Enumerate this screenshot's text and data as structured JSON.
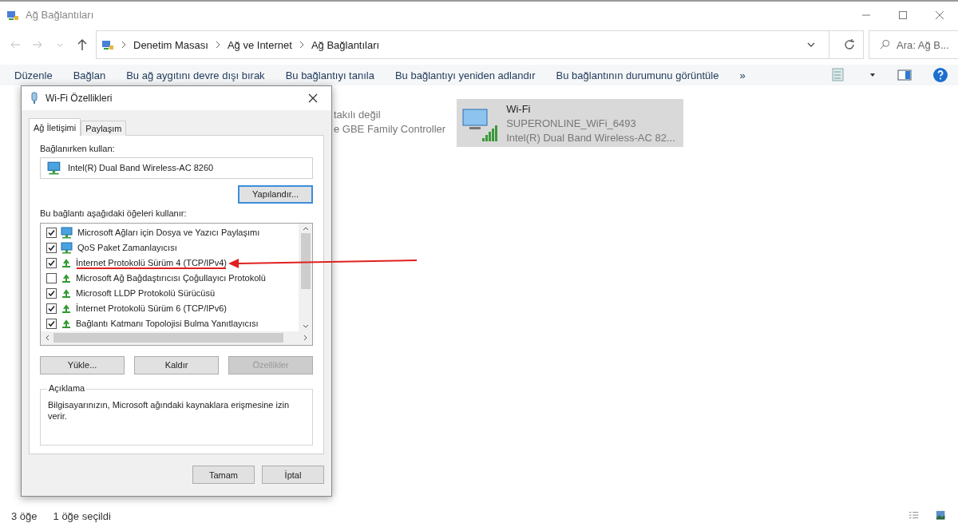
{
  "window": {
    "title": "Ağ Bağlantıları"
  },
  "address_bar": {
    "breadcrumbs": [
      "Denetim Masası",
      "Ağ ve Internet",
      "Ağ Bağlantıları"
    ],
    "search_placeholder": "Ara: Ağ B..."
  },
  "toolbar": {
    "items": [
      "Düzenle",
      "Bağlan",
      "Bu ağ aygıtını devre dışı bırak",
      "Bu bağlantıyı tanıla",
      "Bu bağlantıyı yeniden adlandır",
      "Bu bağlantının durumunu görüntüle"
    ],
    "overflow": "»"
  },
  "connections": [
    {
      "kind": "ethernet",
      "selected": false,
      "lines": [
        "takılı değil",
        "e GBE Family Controller"
      ]
    },
    {
      "kind": "wifi",
      "selected": true,
      "name": "Wi-Fi",
      "lines": [
        "SUPERONLINE_WiFi_6493",
        "Intel(R) Dual Band Wireless-AC 82..."
      ]
    }
  ],
  "status_bar": [
    "3 öğe",
    "1 öğe seçildi"
  ],
  "dialog": {
    "title": "Wi-Fi Özellikleri",
    "tabs": [
      {
        "label": "Ağ İletişimi",
        "selected": true
      },
      {
        "label": "Paylaşım",
        "selected": false
      }
    ],
    "connect_using_label": "Bağlanırken kullan:",
    "adapter": "Intel(R) Dual Band Wireless-AC 8260",
    "configure_button": "Yapılandır...",
    "items_label": "Bu bağlantı aşağıdaki öğeleri kullanır:",
    "items": [
      {
        "kind": "service",
        "label": "Microsoft Ağları için Dosya ve Yazıcı Paylaşımı",
        "checked": true,
        "marked": false
      },
      {
        "kind": "service",
        "label": "QoS Paket Zamanlayıcısı",
        "checked": true,
        "marked": false
      },
      {
        "kind": "protocol",
        "label": "İnternet Protokolü Sürüm 4 (TCP/IPv4)",
        "checked": true,
        "marked": true
      },
      {
        "kind": "protocol",
        "label": "Microsoft Ağ Bağdaştırıcısı Çoğullayıcı Protokolü",
        "checked": false,
        "marked": false
      },
      {
        "kind": "protocol",
        "label": "Microsoft LLDP Protokolü Sürücüsü",
        "checked": true,
        "marked": false
      },
      {
        "kind": "protocol",
        "label": "İnternet Protokolü Sürüm 6 (TCP/IPv6)",
        "checked": true,
        "marked": false
      },
      {
        "kind": "protocol",
        "label": "Bağlantı Katmanı Topolojisi Bulma Yanıtlayıcısı",
        "checked": true,
        "marked": false
      }
    ],
    "buttons": [
      {
        "label": "Yükle...",
        "disabled": false
      },
      {
        "label": "Kaldır",
        "disabled": false
      },
      {
        "label": "Özellikler",
        "disabled": true
      }
    ],
    "description_label": "Açıklama",
    "description": "Bilgisayarınızın, Microsoft ağındaki kaynaklara erişmesine izin verir.",
    "footer_buttons": [
      "Tamam",
      "İptal"
    ]
  }
}
